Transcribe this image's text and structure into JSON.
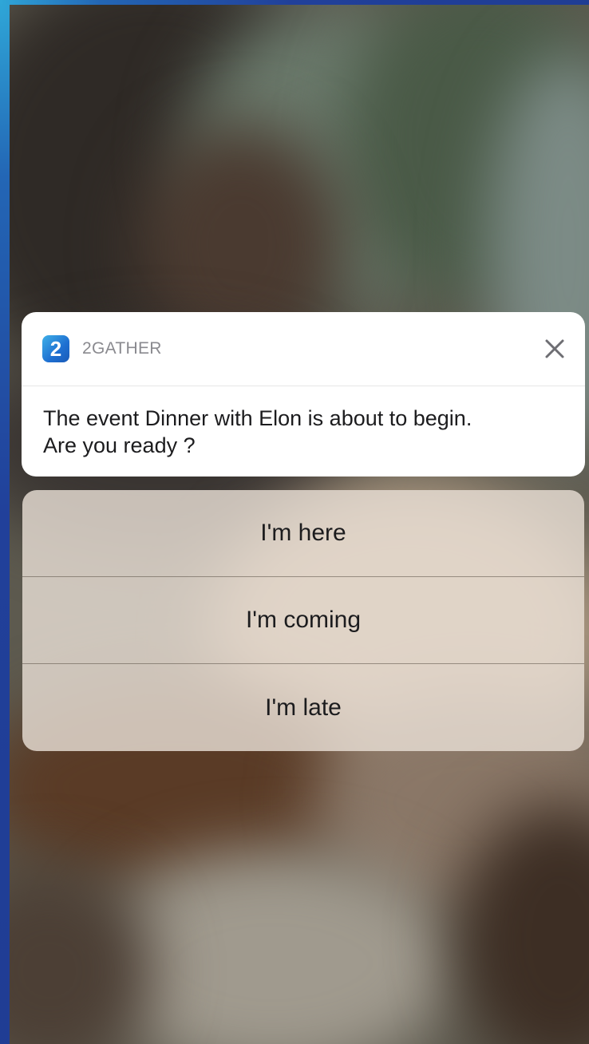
{
  "notification": {
    "app_name": "2GATHER",
    "app_icon": "2gather-app-icon",
    "app_icon_glyph": "2",
    "close_icon": "close-icon",
    "message_line1": "The event Dinner with Elon is about to begin.",
    "message_line2": "Are you ready ?"
  },
  "actions": [
    {
      "label": "I'm here"
    },
    {
      "label": "I'm coming"
    },
    {
      "label": "I'm late"
    }
  ],
  "colors": {
    "frame": "#1e3a8f",
    "card": "#ffffff",
    "app_icon": "#1e6fd1",
    "app_name_text": "#8a8a8f",
    "text": "#1c1c1e"
  }
}
